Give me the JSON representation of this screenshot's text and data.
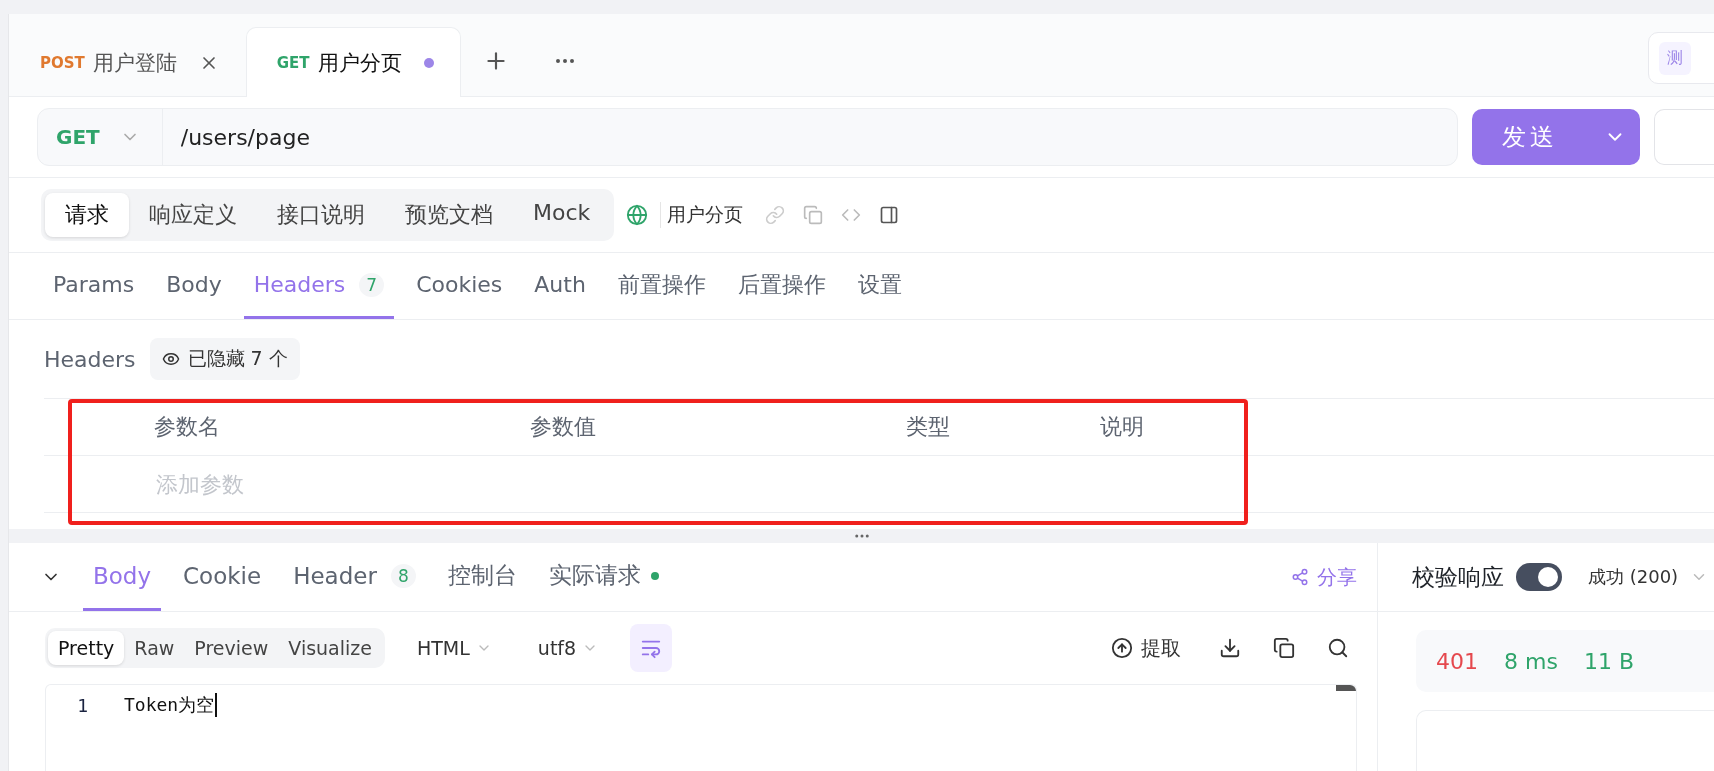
{
  "request_tabs": [
    {
      "method": "POST",
      "color": "#e0792f",
      "title": "用户登陆",
      "selected": false,
      "closable": true,
      "modified": false
    },
    {
      "method": "GET",
      "color": "#2fa46a",
      "title": "用户分页",
      "selected": true,
      "closable": false,
      "modified": true
    }
  ],
  "env_badge": "测",
  "url_bar": {
    "method": "GET",
    "url": "/users/page",
    "send_label": "发送"
  },
  "view_tabs": [
    {
      "label": "请求",
      "selected": true
    },
    {
      "label": "响应定义",
      "selected": false
    },
    {
      "label": "接口说明",
      "selected": false
    },
    {
      "label": "预览文档",
      "selected": false
    },
    {
      "label": "Mock",
      "selected": false
    }
  ],
  "endpoint_name": "用户分页",
  "param_tabs": [
    {
      "label": "Params",
      "selected": false
    },
    {
      "label": "Body",
      "selected": false
    },
    {
      "label": "Headers",
      "count": "7",
      "selected": true
    },
    {
      "label": "Cookies",
      "selected": false
    },
    {
      "label": "Auth",
      "selected": false
    },
    {
      "label": "前置操作",
      "selected": false
    },
    {
      "label": "后置操作",
      "selected": false
    },
    {
      "label": "设置",
      "selected": false
    }
  ],
  "headers_section": {
    "title": "Headers",
    "hidden_label": "已隐藏 7 个"
  },
  "table": {
    "columns": [
      "参数名",
      "参数值",
      "类型",
      "说明"
    ],
    "placeholder": "添加参数"
  },
  "response": {
    "tabs": [
      {
        "label": "Body",
        "selected": true
      },
      {
        "label": "Cookie",
        "selected": false
      },
      {
        "label": "Header",
        "count": "8",
        "selected": false
      },
      {
        "label": "控制台",
        "selected": false
      },
      {
        "label": "实际请求",
        "selected": false,
        "dot": true
      }
    ],
    "share_label": "分享",
    "formats": [
      {
        "label": "Pretty",
        "selected": true
      },
      {
        "label": "Raw",
        "selected": false
      },
      {
        "label": "Preview",
        "selected": false
      },
      {
        "label": "Visualize",
        "selected": false
      }
    ],
    "content_type": "HTML",
    "encoding": "utf8",
    "wrap": true,
    "extract_label": "提取",
    "lines": [
      {
        "number": "1",
        "text": "Token为空"
      }
    ]
  },
  "validation": {
    "label": "校验响应",
    "on": true,
    "status": "成功 (200)"
  },
  "metrics": [
    {
      "text": "401",
      "color": "#e5484d"
    },
    {
      "text": "8 ms",
      "color": "#2fa46a"
    },
    {
      "text": "11 B",
      "color": "#2fa46a"
    }
  ]
}
